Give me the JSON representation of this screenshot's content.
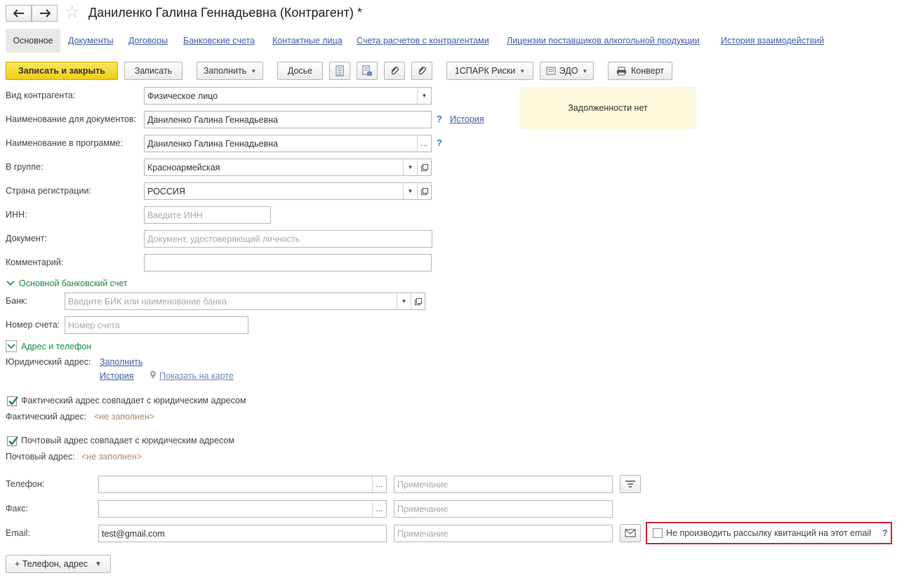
{
  "window": {
    "title": "Даниленко Галина Геннадьевна (Контрагент) *"
  },
  "tabs": [
    {
      "label": "Основное",
      "active": true
    },
    {
      "label": "Документы"
    },
    {
      "label": "Договоры"
    },
    {
      "label": "Банковские счета"
    },
    {
      "label": "Контактные лица"
    },
    {
      "label": "Счета расчетов с контрагентами"
    },
    {
      "label": "Лицензии поставщиков алкогольной продукции"
    },
    {
      "label": "История взаимодействий"
    }
  ],
  "toolbar": {
    "save_close": "Записать и закрыть",
    "save": "Записать",
    "fill": "Заполнить",
    "dossier": "Досье",
    "spark": "1СПАРК Риски",
    "edo": "ЭДО",
    "envelope": "Конверт"
  },
  "debt": {
    "text": "Задолженности нет"
  },
  "form": {
    "kind": {
      "label": "Вид контрагента:",
      "value": "Физическое лицо"
    },
    "doc_name": {
      "label": "Наименование для документов:",
      "value": "Даниленко Галина Геннадьевна",
      "help": "?",
      "history": "История"
    },
    "prog_name": {
      "label": "Наименование в программе:",
      "value": "Даниленко Галина Геннадьевна",
      "help": "?"
    },
    "group": {
      "label": "В группе:",
      "value": "Красноармейская"
    },
    "country": {
      "label": "Страна регистрации:",
      "value": "РОССИЯ"
    },
    "inn": {
      "label": "ИНН:",
      "placeholder": "Введите ИНН"
    },
    "document": {
      "label": "Документ:",
      "placeholder": "Документ, удостоверяющий личность"
    },
    "comment": {
      "label": "Комментарий:",
      "value": ""
    }
  },
  "bank_group": {
    "title": "Основной банковский счет",
    "bank": {
      "label": "Банк:",
      "placeholder": "Введите БИК или наименование банка"
    },
    "account": {
      "label": "Номер счета:",
      "placeholder": "Номер счета"
    }
  },
  "address_group": {
    "title": "Адрес и телефон",
    "legal": {
      "label": "Юридический адрес:",
      "fill": "Заполнить",
      "history": "История",
      "map": "Показать на карте"
    },
    "actual_same": {
      "label": "Фактический адрес совпадает с юридическим адресом",
      "checked": true
    },
    "actual": {
      "label": "Фактический адрес:",
      "value": "<не заполнен>"
    },
    "postal_same": {
      "label": "Почтовый адрес совпадает с юридическим адресом",
      "checked": true
    },
    "postal": {
      "label": "Почтовый адрес:",
      "value": "<не заполнен>"
    }
  },
  "contacts": {
    "phone": {
      "label": "Телефон:",
      "value": "",
      "note_placeholder": "Примечание"
    },
    "fax": {
      "label": "Факс:",
      "value": "",
      "note_placeholder": "Примечание"
    },
    "email": {
      "label": "Email:",
      "value": "test@gmail.com",
      "note_placeholder": "Примечание"
    },
    "no_receipts": {
      "label": "Не производить рассылку квитанций на этот email",
      "help": "?",
      "checked": false
    },
    "add_button": "+ Телефон, адрес"
  },
  "colors": {
    "accent_yellow": "#f5d322",
    "link_blue": "#3c5ea8",
    "group_green": "#1b8a4a",
    "highlight_red": "#d1242f",
    "debt_bg": "#fdf9dc"
  }
}
